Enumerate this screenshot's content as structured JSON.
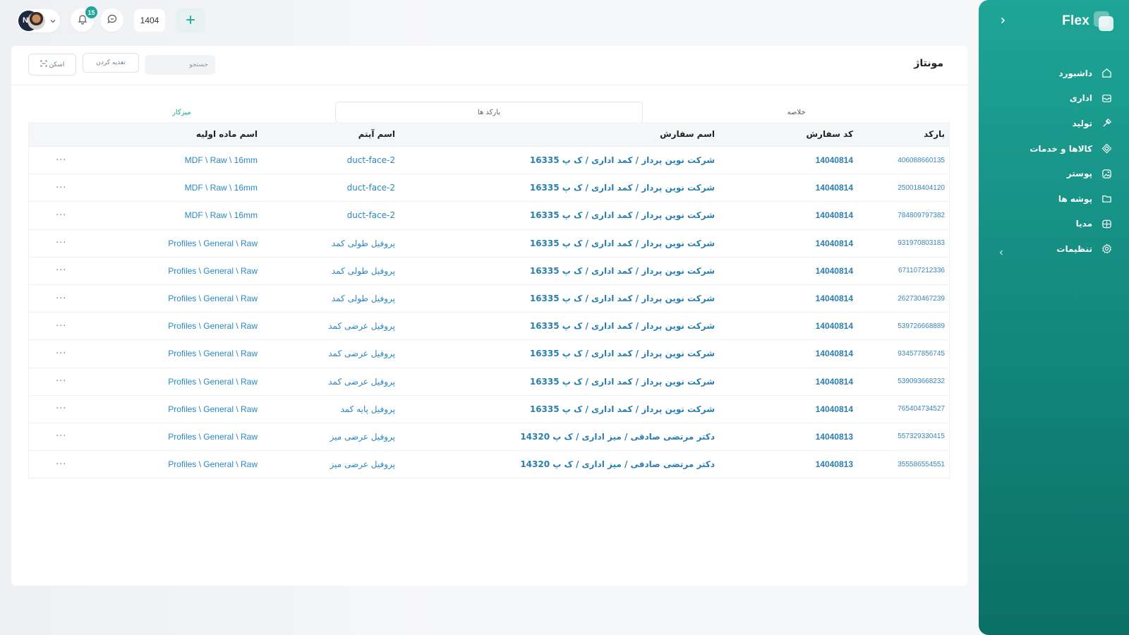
{
  "app": {
    "brand": "Flex"
  },
  "topbar": {
    "notification_count": "15",
    "year": "1404",
    "add_label": "+",
    "avatar_initial": "N"
  },
  "sidebar": {
    "items": [
      {
        "label": "داشبورد",
        "icon": "home-icon"
      },
      {
        "label": "اداری",
        "icon": "inbox-icon"
      },
      {
        "label": "تولید",
        "icon": "tool-icon"
      },
      {
        "label": "کالاها و خدمات",
        "icon": "cube-icon"
      },
      {
        "label": "پوستر",
        "icon": "image-icon"
      },
      {
        "label": "پوشه ها",
        "icon": "folder-icon"
      },
      {
        "label": "مدیا",
        "icon": "media-icon"
      },
      {
        "label": "تنظیمات",
        "icon": "settings-icon"
      }
    ]
  },
  "page": {
    "title": "مونتاژ",
    "scan_label": "اسکن",
    "feed_label": "تغذیه کردن",
    "search_placeholder": "جستجو"
  },
  "tabs": [
    {
      "label": "خلاصه"
    },
    {
      "label": "بارکد ها"
    },
    {
      "label": "میزکار"
    }
  ],
  "table": {
    "headers": {
      "barcode": "بارکد",
      "order_code": "کد سفارش",
      "order_name": "اسم سفارش",
      "item_name": "اسم آیتم",
      "material": "اسم ماده اولیه"
    },
    "rows": [
      {
        "barcode": "406088660135",
        "order_code": "14040814",
        "order_name": "شرکت نوین پرداز / کمد اداری / ک پ 16335",
        "item_name": "duct-face-2",
        "material": "MDF \\ Raw \\ 16mm"
      },
      {
        "barcode": "250018404120",
        "order_code": "14040814",
        "order_name": "شرکت نوین پرداز / کمد اداری / ک پ 16335",
        "item_name": "duct-face-2",
        "material": "MDF \\ Raw \\ 16mm"
      },
      {
        "barcode": "784809797382",
        "order_code": "14040814",
        "order_name": "شرکت نوین پرداز / کمد اداری / ک پ 16335",
        "item_name": "duct-face-2",
        "material": "MDF \\ Raw \\ 16mm"
      },
      {
        "barcode": "931970803183",
        "order_code": "14040814",
        "order_name": "شرکت نوین پرداز / کمد اداری / ک پ 16335",
        "item_name": "پروفیل طولی کمد",
        "material": "Profiles \\ General \\ Raw"
      },
      {
        "barcode": "671107212336",
        "order_code": "14040814",
        "order_name": "شرکت نوین پرداز / کمد اداری / ک پ 16335",
        "item_name": "پروفیل طولی کمد",
        "material": "Profiles \\ General \\ Raw"
      },
      {
        "barcode": "262730467239",
        "order_code": "14040814",
        "order_name": "شرکت نوین پرداز / کمد اداری / ک پ 16335",
        "item_name": "پروفیل طولی کمد",
        "material": "Profiles \\ General \\ Raw"
      },
      {
        "barcode": "539726668889",
        "order_code": "14040814",
        "order_name": "شرکت نوین پرداز / کمد اداری / ک پ 16335",
        "item_name": "پروفیل عرضی کمد",
        "material": "Profiles \\ General \\ Raw"
      },
      {
        "barcode": "934577856745",
        "order_code": "14040814",
        "order_name": "شرکت نوین پرداز / کمد اداری / ک پ 16335",
        "item_name": "پروفیل عرضی کمد",
        "material": "Profiles \\ General \\ Raw"
      },
      {
        "barcode": "539093668232",
        "order_code": "14040814",
        "order_name": "شرکت نوین پرداز / کمد اداری / ک پ 16335",
        "item_name": "پروفیل عرضی کمد",
        "material": "Profiles \\ General \\ Raw"
      },
      {
        "barcode": "765404734527",
        "order_code": "14040814",
        "order_name": "شرکت نوین پرداز / کمد اداری / ک پ 16335",
        "item_name": "پروفیل پایه کمد",
        "material": "Profiles \\ General \\ Raw"
      },
      {
        "barcode": "557329330415",
        "order_code": "14040813",
        "order_name": "دکتر مرتضی صادقی / میز اداری / ک پ 14320",
        "item_name": "پروفیل عرضی میز",
        "material": "Profiles \\ General \\ Raw"
      },
      {
        "barcode": "355586554551",
        "order_code": "14040813",
        "order_name": "دکتر مرتضی صادقی / میز اداری / ک پ 14320",
        "item_name": "پروفیل عرضی میز",
        "material": "Profiles \\ General \\ Raw"
      }
    ],
    "more_label": "···"
  },
  "colors": {
    "accent": "#1ea596",
    "link": "#2a7fb0"
  }
}
